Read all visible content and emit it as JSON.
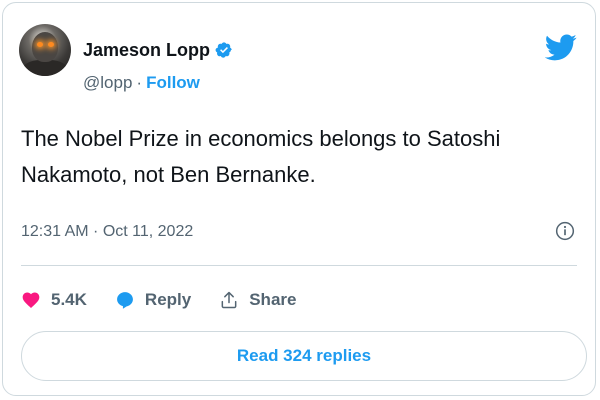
{
  "author": {
    "name": "Jameson Lopp",
    "handle": "@lopp",
    "separator": "·",
    "follow_label": "Follow",
    "verified_icon": "verified-badge-icon"
  },
  "brand_icon": "twitter-bird-icon",
  "tweet": {
    "text": "The Nobel Prize in economics belongs to Satoshi Nakamoto, not Ben Bernanke.",
    "timestamp": "12:31 AM · Oct 11, 2022"
  },
  "actions": {
    "like_count": "5.4K",
    "reply_label": "Reply",
    "share_label": "Share"
  },
  "read_replies_label": "Read 324 replies",
  "colors": {
    "accent": "#1d9bf0",
    "like": "#f91880",
    "muted_text": "#536471",
    "border": "#cfd9de"
  }
}
